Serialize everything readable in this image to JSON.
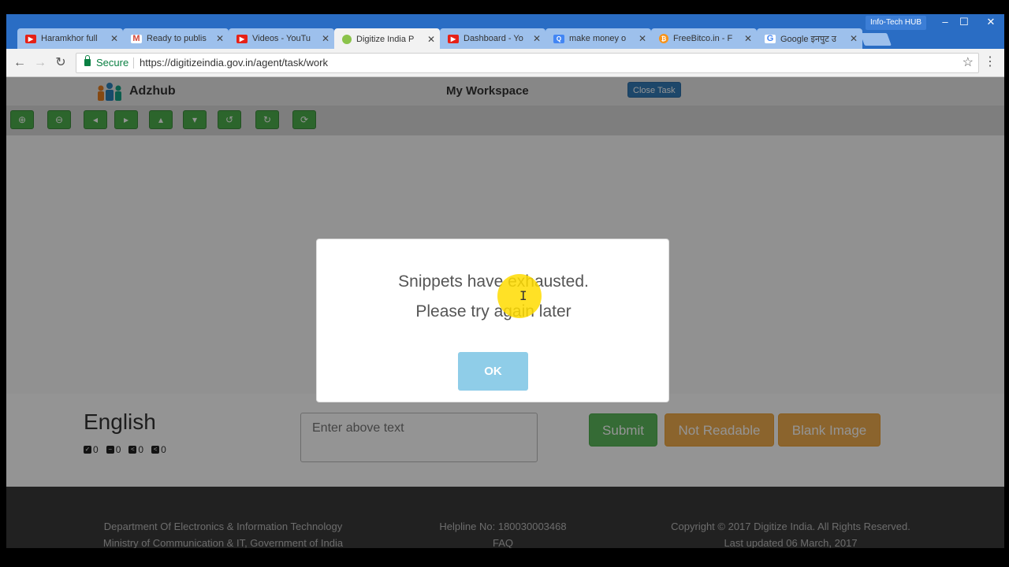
{
  "browser": {
    "tabs": [
      {
        "title": "Haramkhor full",
        "icon": "youtube-icon",
        "color": "#e62117"
      },
      {
        "title": "Ready to publis",
        "icon": "gmail-icon",
        "color": "#d44638"
      },
      {
        "title": "Videos - YouTu",
        "icon": "youtube-icon",
        "color": "#e62117"
      },
      {
        "title": "Digitize India P",
        "icon": "digitize-india-icon",
        "color": "#8bc34a",
        "active": true
      },
      {
        "title": "Dashboard - Yo",
        "icon": "youtube-icon",
        "color": "#e62117"
      },
      {
        "title": "make money o",
        "icon": "search-icon",
        "color": "#4285f4"
      },
      {
        "title": "FreeBitco.in - F",
        "icon": "bitcoin-icon",
        "color": "#f7931a"
      },
      {
        "title": "Google इनपुट उ",
        "icon": "google-icon",
        "color": "#4285f4"
      }
    ],
    "profile_label": "Info-Tech HUB",
    "secure_label": "Secure",
    "url": "https://digitizeindia.gov.in/agent/task/work"
  },
  "header": {
    "brand": "Adzhub",
    "title": "My Workspace",
    "close_task": "Close Task"
  },
  "image_tools": [
    "zoom-in-icon",
    "zoom-out-icon",
    "arrow-left-icon",
    "arrow-right-icon",
    "arrow-up-icon",
    "arrow-down-icon",
    "rotate-left-icon",
    "rotate-right-icon",
    "refresh-icon"
  ],
  "form": {
    "language": "English",
    "stats": [
      "0",
      "0",
      "0",
      "0"
    ],
    "input_placeholder": "Enter above text",
    "submit": "Submit",
    "not_readable": "Not Readable",
    "blank_image": "Blank Image"
  },
  "footer": {
    "dept": "Department Of Electronics & Information Technology",
    "ministry": "Ministry of Communication & IT, Government of India",
    "helpline": "Helpline No: 180030003468",
    "faq": "FAQ",
    "copyright": "Copyright © 2017 Digitize India. All Rights Reserved.",
    "updated": "Last updated 06 March, 2017"
  },
  "modal": {
    "line1": "Snippets have exhausted.",
    "line2": "Please try again later",
    "ok": "OK"
  }
}
